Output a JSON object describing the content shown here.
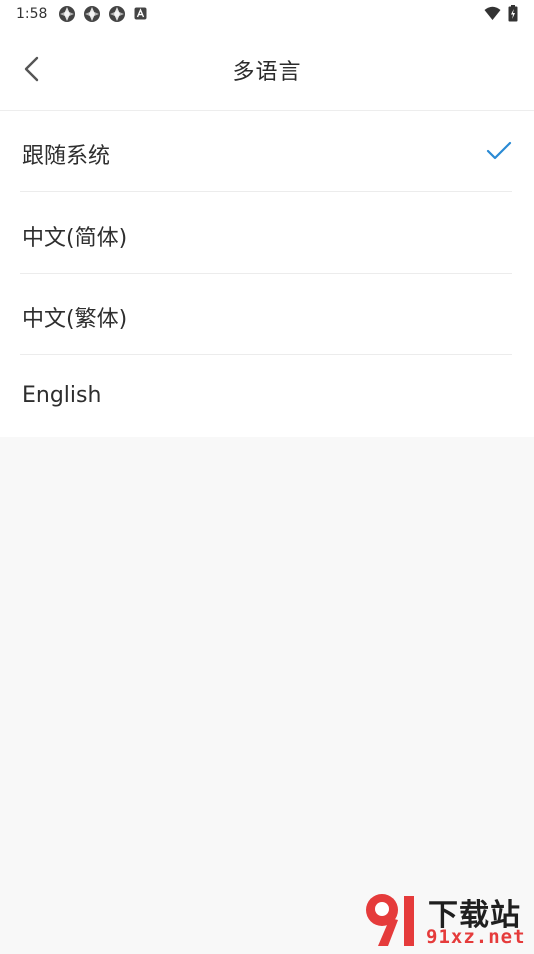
{
  "status_bar": {
    "time": "1:58",
    "icons": [
      "app-notification-icon",
      "app-notification-icon",
      "app-notification-icon",
      "keyboard-a-icon",
      "wifi-icon",
      "battery-icon"
    ]
  },
  "header": {
    "title": "多语言",
    "back_icon": "chevron-left-icon"
  },
  "language_options": [
    {
      "label": "跟随系统",
      "selected": true
    },
    {
      "label": "中文(简体)",
      "selected": false
    },
    {
      "label": "中文(繁体)",
      "selected": false
    },
    {
      "label": "English",
      "selected": false
    }
  ],
  "colors": {
    "accent_check": "#2a8ad4",
    "watermark_red": "#e53b3b"
  },
  "watermark": {
    "logo_text": "91",
    "title": "下载站",
    "url": "91xz.net"
  }
}
